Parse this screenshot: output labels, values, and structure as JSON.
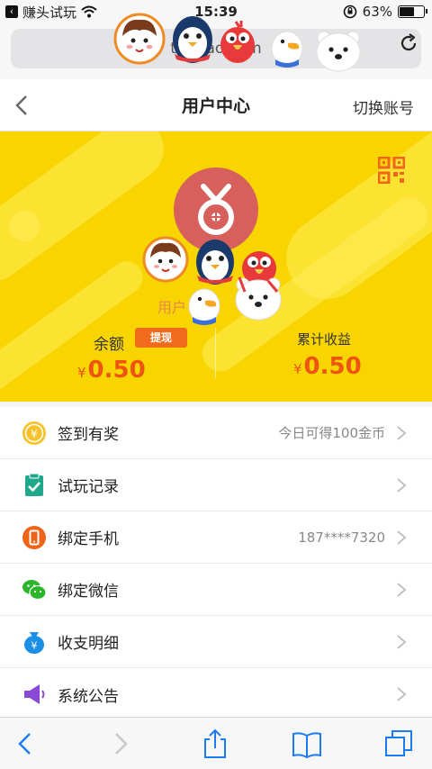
{
  "status_bar": {
    "back_app": "赚头试玩",
    "time": "15:39",
    "battery_percent": "63%",
    "battery_level": 0.63
  },
  "url_bar": {
    "text": "toutiao.com"
  },
  "nav": {
    "title": "用户中心",
    "switch_account": "切换账号"
  },
  "profile": {
    "user_name": "用户",
    "balance_label": "余额",
    "withdraw_label": "提现",
    "balance_currency": "¥",
    "balance_value": "0.50",
    "income_label": "累计收益",
    "income_currency": "¥",
    "income_value": "0.50"
  },
  "menu": [
    {
      "label": "签到有奖",
      "value": "今日可得100金币",
      "icon": "coin-icon"
    },
    {
      "label": "试玩记录",
      "value": "",
      "icon": "clipboard-check-icon"
    },
    {
      "label": "绑定手机",
      "value": "187****7320",
      "icon": "phone-icon"
    },
    {
      "label": "绑定微信",
      "value": "",
      "icon": "wechat-icon"
    },
    {
      "label": "收支明细",
      "value": "",
      "icon": "money-bag-icon"
    },
    {
      "label": "系统公告",
      "value": "",
      "icon": "speaker-icon"
    }
  ],
  "colors": {
    "banner": "#f8d400",
    "accent": "#ee5511",
    "withdraw": "#f26a1b"
  }
}
